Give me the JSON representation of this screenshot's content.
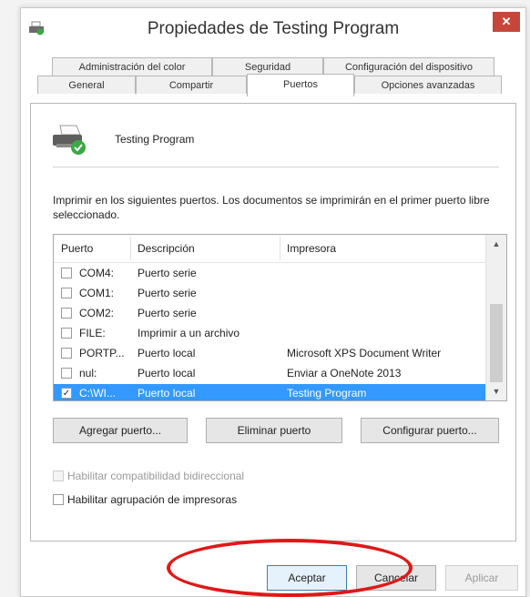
{
  "window": {
    "title": "Propiedades de Testing Program",
    "close_glyph": "✕"
  },
  "tabs_row1": [
    "Administración del color",
    "Seguridad",
    "Configuración del dispositivo"
  ],
  "tabs_row2": [
    "General",
    "Compartir",
    "Puertos",
    "Opciones avanzadas"
  ],
  "active_tab": "Puertos",
  "printer": {
    "name": "Testing Program",
    "icon": "printer-icon"
  },
  "description": "Imprimir en los siguientes puertos. Los documentos se imprimirán en el primer puerto libre seleccionado.",
  "ports_table": {
    "columns": [
      "Puerto",
      "Descripción",
      "Impresora"
    ],
    "rows": [
      {
        "checked": false,
        "port": "COM4:",
        "description": "Puerto serie",
        "printer": ""
      },
      {
        "checked": false,
        "port": "COM1:",
        "description": "Puerto serie",
        "printer": ""
      },
      {
        "checked": false,
        "port": "COM2:",
        "description": "Puerto serie",
        "printer": ""
      },
      {
        "checked": false,
        "port": "FILE:",
        "description": "Imprimir a un archivo",
        "printer": ""
      },
      {
        "checked": false,
        "port": "PORTP...",
        "description": "Puerto local",
        "printer": "Microsoft XPS Document Writer"
      },
      {
        "checked": false,
        "port": "nul:",
        "description": "Puerto local",
        "printer": "Enviar a OneNote 2013"
      },
      {
        "checked": true,
        "port": "C:\\WI...",
        "description": "Puerto local",
        "printer": "Testing Program",
        "selected": true
      }
    ]
  },
  "port_buttons": {
    "add": "Agregar puerto...",
    "delete": "Eliminar puerto",
    "configure": "Configurar puerto..."
  },
  "options": {
    "bidirectional": "Habilitar compatibilidad bidireccional",
    "pooling": "Habilitar agrupación de impresoras"
  },
  "dialog_buttons": {
    "ok": "Aceptar",
    "cancel": "Cancelar",
    "apply": "Aplicar"
  },
  "colors": {
    "selection": "#3399ff",
    "close_button": "#c7463a",
    "highlight_ellipse": "#e01818"
  }
}
